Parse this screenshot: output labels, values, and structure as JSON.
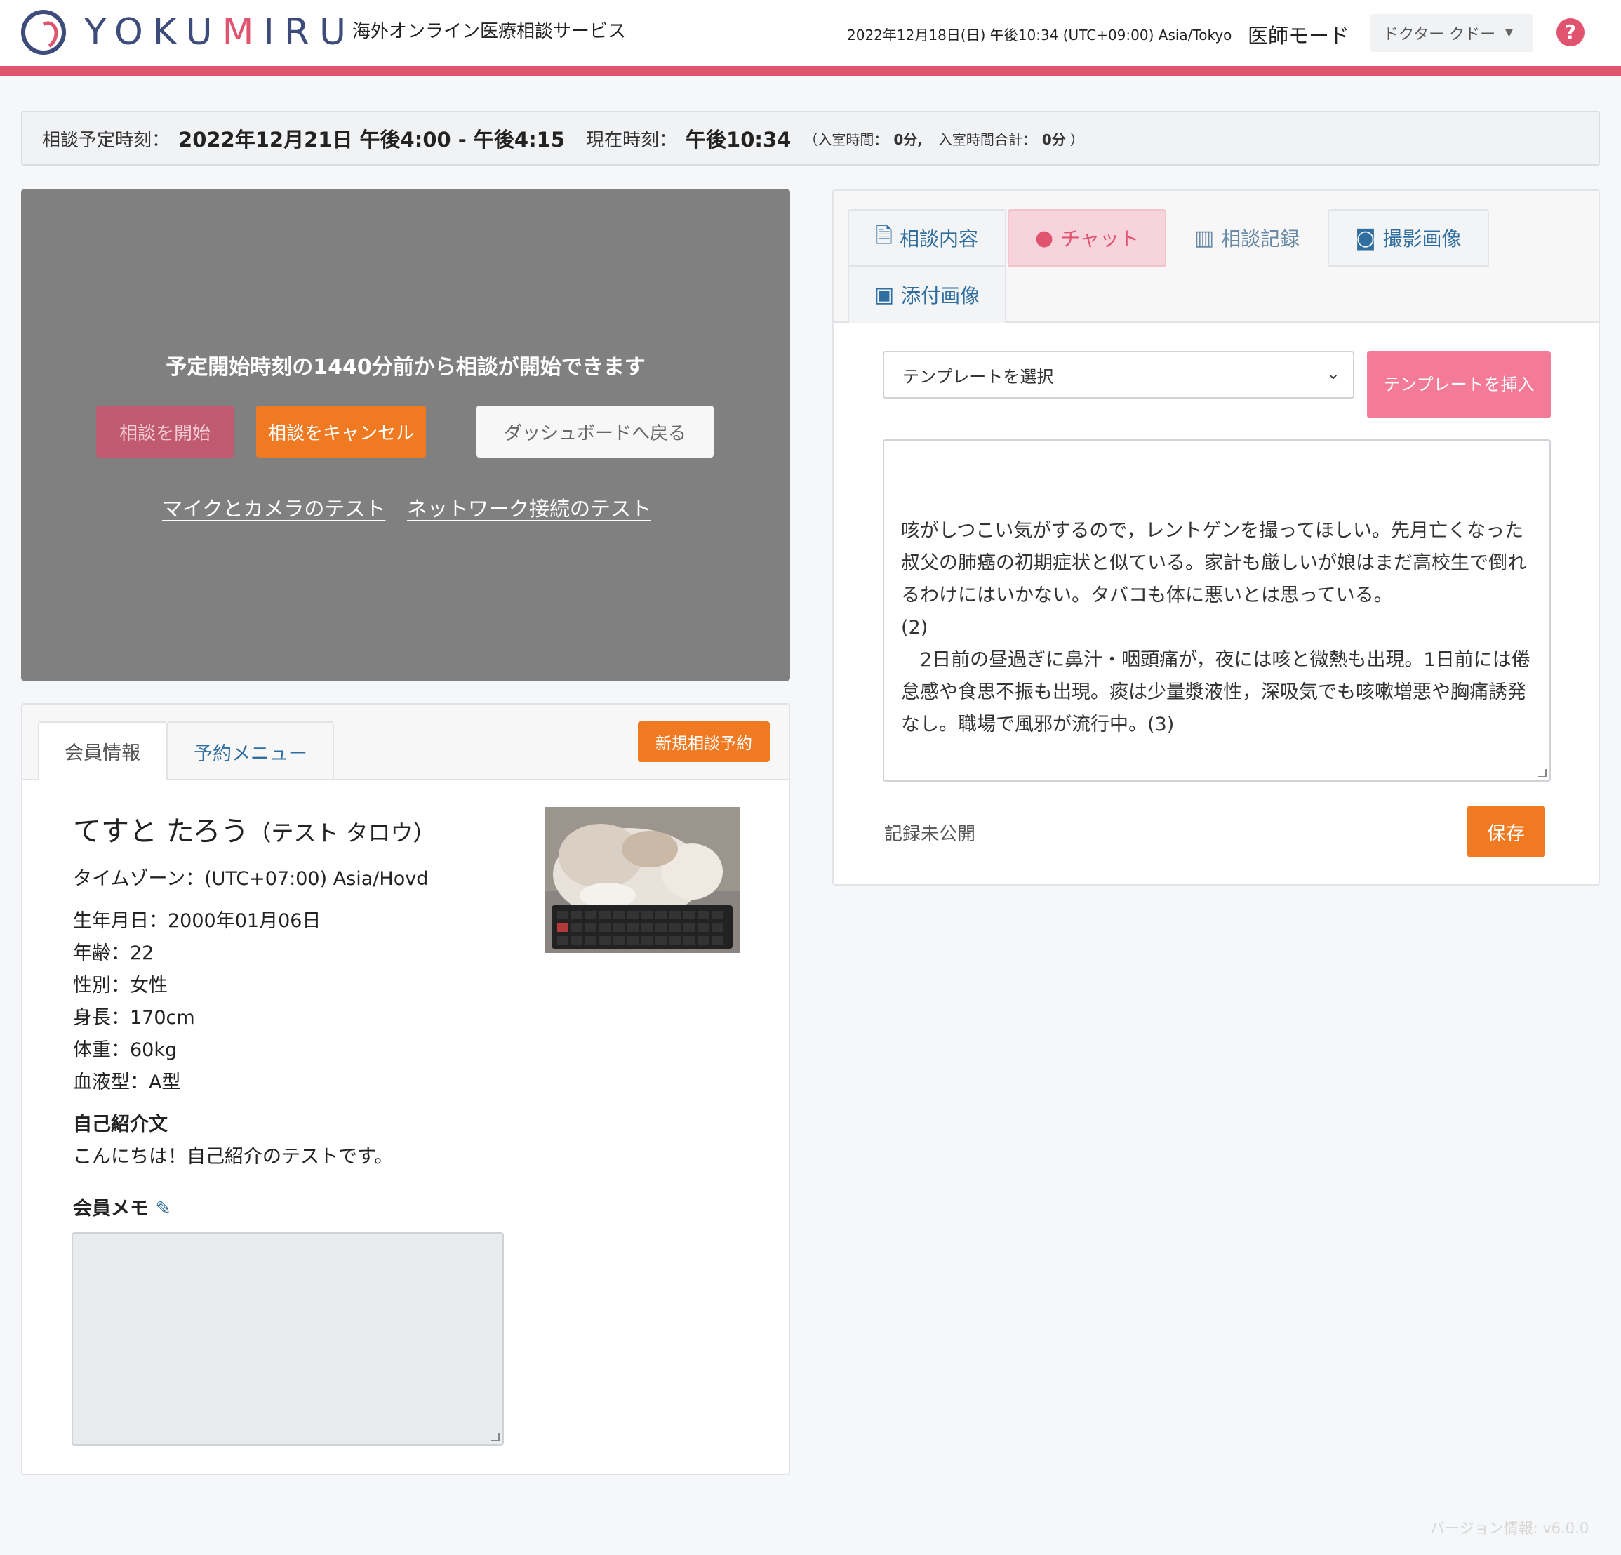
{
  "header": {
    "logo_prefix": "YOKU",
    "logo_m": "M",
    "logo_suffix": "IRU",
    "tagline": "海外オンライン医療相談サービス",
    "datetime": "2022年12月18日(日) 午後10:34 (UTC+09:00) Asia/Tokyo",
    "mode": "医師モード",
    "doctor": "ドクター クドー",
    "help": "?"
  },
  "infobar": {
    "scheduled_label": "相談予定時刻：",
    "scheduled_value": "2022年12月21日 午後4:00 - 午後4:15",
    "current_label": "現在時刻：",
    "current_value": "午後10:34",
    "paren_open": "（",
    "room_time_label": "入室時間：",
    "room_time_value": "0分,",
    "room_total_label": "入室時間合計：",
    "room_total_value": "0分",
    "paren_close": "）"
  },
  "video": {
    "message": "予定開始時刻の1440分前から相談が開始できます",
    "start_button": "相談を開始",
    "cancel_button": "相談をキャンセル",
    "back_button": "ダッシュボードへ戻る",
    "mic_camera_test": "マイクとカメラのテスト",
    "network_test": "ネットワーク接続のテスト"
  },
  "member": {
    "tabs": [
      "会員情報",
      "予約メニュー"
    ],
    "new_reservation": "新規相談予約",
    "name": "てすと たろう",
    "name_kana": "（テスト タロウ）",
    "timezone": "タイムゾーン：(UTC+07:00) Asia/Hovd",
    "birthday": "生年月日：2000年01月06日",
    "age": "年齢：22",
    "gender": "性別：女性",
    "height": "身長：170cm",
    "weight": "体重：60kg",
    "blood": "血液型：A型",
    "intro_heading": "自己紹介文",
    "intro_text": "こんにちは！自己紹介のテストです。",
    "memo_heading": "会員メモ",
    "memo_value": ""
  },
  "right": {
    "tabs": {
      "consult": "相談内容",
      "chat": "チャット",
      "record": "相談記録",
      "photo": "撮影画像",
      "attach": "添付画像"
    },
    "template_placeholder": "テンプレートを選択",
    "insert_button": "テンプレートを挿入",
    "chat_text": "咳がしつこい気がするので，レントゲンを撮ってほしい。先月亡くなった叔父の肺癌の初期症状と似ている。家計も厳しいが娘はまだ高校生で倒れるわけにはいかない。タバコも体に悪いとは思っている。\n(2)\n　2日前の昼過ぎに鼻汁・咽頭痛が，夜には咳と微熱も出現。1日前には倦怠感や食思不振も出現。痰は少量漿液性，深吸気でも咳嗽増悪や胸痛誘発なし。職場で風邪が流行中。(3)",
    "unpublished": "記録未公開",
    "save_button": "保存"
  },
  "footer": {
    "version": "バージョン情報: v6.0.0"
  },
  "colors": {
    "brand_navy": "#3d4c7a",
    "brand_pink": "#e0546f",
    "orange": "#f07a22",
    "link_blue": "#2f6e9f"
  }
}
